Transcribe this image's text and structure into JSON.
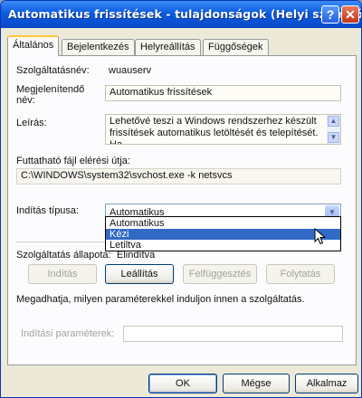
{
  "window": {
    "title": "Automatikus frissítések - tulajdonságok (Helyi számító...",
    "help_glyph": "?",
    "close_glyph": "✕"
  },
  "tabs": [
    {
      "label": "Általános"
    },
    {
      "label": "Bejelentkezés"
    },
    {
      "label": "Helyreállítás"
    },
    {
      "label": "Függőségek"
    }
  ],
  "general": {
    "service_name_label": "Szolgáltatásnév:",
    "service_name_value": "wuauserv",
    "display_name_label": "Megjelenítendő név:",
    "display_name_value": "Automatikus frissítések",
    "description_label": "Leírás:",
    "description_value": "Lehetővé teszi a Windows rendszerhez készült frissítések automatikus letöltését és telepítését. Ha",
    "exe_path_label": "Futtatható fájl elérési útja:",
    "exe_path_value": "C:\\WINDOWS\\system32\\svchost.exe -k netsvcs",
    "startup_type_label": "Indítás típusa:",
    "startup_type_value": "Automatikus",
    "startup_options": [
      "Automatikus",
      "Kézi",
      "Letiltva"
    ],
    "startup_highlighted": "Kézi",
    "status_label": "Szolgáltatás állapota:",
    "status_value": "Elindítva",
    "buttons": {
      "start": "Indítás",
      "stop": "Leállítás",
      "pause": "Felfüggesztés",
      "resume": "Folytatás"
    },
    "params_hint": "Megadhatja, milyen paraméterekkel induljon innen a szolgáltatás.",
    "params_label": "Indítási paraméterek:",
    "params_value": ""
  },
  "footer": {
    "ok": "OK",
    "cancel": "Mégse",
    "apply": "Alkalmaz"
  },
  "icons": [
    "help-icon",
    "close-icon",
    "scroll-up-icon",
    "scroll-down-icon",
    "dropdown-arrow-icon",
    "mouse-cursor-icon"
  ],
  "colors": {
    "titlebar": "#0a4fd0",
    "selection": "#316ac5",
    "tab_accent": "#ffc83c"
  }
}
